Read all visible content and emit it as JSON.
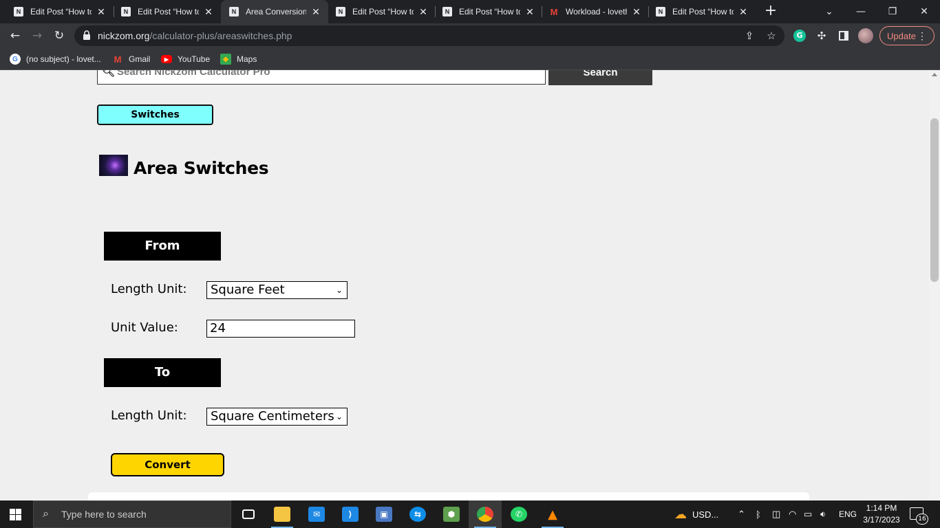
{
  "browser": {
    "tabs": [
      {
        "title": "Edit Post “How to",
        "favicon": "N",
        "active": false
      },
      {
        "title": "Edit Post “How to",
        "favicon": "N",
        "active": false
      },
      {
        "title": "Area Conversion",
        "favicon": "N",
        "active": true
      },
      {
        "title": "Edit Post “How to",
        "favicon": "N",
        "active": false
      },
      {
        "title": "Edit Post “How to",
        "favicon": "N",
        "active": false
      },
      {
        "title": "Workload - loveth",
        "favicon": "M",
        "active": false
      },
      {
        "title": "Edit Post “How to",
        "favicon": "N",
        "active": false
      }
    ],
    "url_host": "nickzom.org",
    "url_path": "/calculator-plus/areaswitches.php",
    "extension_letter": "G",
    "update_label": "Update",
    "bookmarks": [
      {
        "label": "(no subject) - lovet...",
        "icon": "google-icon"
      },
      {
        "label": "Gmail",
        "icon": "gmail-icon"
      },
      {
        "label": "YouTube",
        "icon": "youtube-icon"
      },
      {
        "label": "Maps",
        "icon": "maps-icon"
      }
    ]
  },
  "page": {
    "search_placeholder": "Search Nickzom Calculator Pro",
    "search_button": "Search",
    "switches_button": "Switches",
    "title": "Area Switches",
    "from_header": "From",
    "to_header": "To",
    "from_unit_label": "Length Unit:",
    "from_unit_value": "Square Feet",
    "unit_value_label": "Unit Value:",
    "unit_value": "24",
    "to_unit_label": "Length Unit:",
    "to_unit_value": "Square Centimeters",
    "convert_button": "Convert"
  },
  "taskbar": {
    "search_placeholder": "Type here to search",
    "weather_text": "USD...",
    "language": "ENG",
    "time": "1:14 PM",
    "date": "3/17/2023",
    "notification_count": "16"
  },
  "colors": {
    "switches_bg": "#80ffff",
    "convert_bg": "#ffd500",
    "section_header_bg": "#000000",
    "chrome_dark": "#202124",
    "chrome_toolbar": "#35363a"
  }
}
